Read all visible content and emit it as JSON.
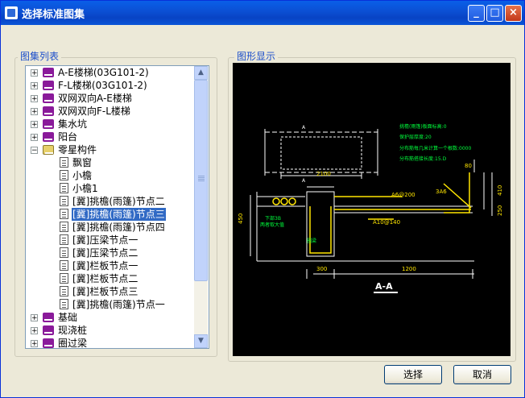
{
  "window": {
    "title": "选择标准图集"
  },
  "titlebar": {
    "min_glyph": "_",
    "max_glyph": "□",
    "close_glyph": "×"
  },
  "left_group": {
    "label": "图集列表"
  },
  "right_group": {
    "label": "图形显示"
  },
  "tree": {
    "nodes": [
      {
        "label": "A-E楼梯(03G101-2)"
      },
      {
        "label": "F-L楼梯(03G101-2)"
      },
      {
        "label": "双网双向A-E楼梯"
      },
      {
        "label": "双网双向F-L楼梯"
      },
      {
        "label": "集水坑"
      },
      {
        "label": "阳台"
      },
      {
        "label": "零星构件"
      },
      {
        "label": "飘窗"
      },
      {
        "label": "小檐"
      },
      {
        "label": "小檐1"
      },
      {
        "label": "[冀]挑檐(雨篷)节点二"
      },
      {
        "label": "[冀]挑檐(雨篷)节点三"
      },
      {
        "label": "[冀]挑檐(雨篷)节点四"
      },
      {
        "label": "[冀]压梁节点一"
      },
      {
        "label": "[冀]压梁节点二"
      },
      {
        "label": "[冀]栏板节点一"
      },
      {
        "label": "[冀]栏板节点二"
      },
      {
        "label": "[冀]栏板节点三"
      },
      {
        "label": "[冀]挑檐(雨篷)节点一"
      },
      {
        "label": "基础"
      },
      {
        "label": "现浇桩"
      },
      {
        "label": "圈过梁"
      }
    ],
    "plus": "+",
    "minus": "−"
  },
  "scrollbar": {
    "up": "▲",
    "down": "▼"
  },
  "drawing": {
    "section_mark": "A",
    "dim_top": "2100",
    "dim_bottom_left": "300",
    "dim_bottom_right": "1200",
    "dim_height_left": "450",
    "dim_right_1": "410",
    "dim_right_2": "250",
    "dim_right_top": "80",
    "rebar_1": "A6@200",
    "rebar_2": "3A6",
    "rebar_3": "A10@140",
    "beam_label": "圈梁",
    "left_note_1": "下部3B",
    "left_note_2": "两者取大值",
    "note_1": "挑檐(雨篷)板面标高:0",
    "note_2": "保护层厚度:20",
    "note_3": "分布筋每几米计算一个根数:0000",
    "note_4": "分布筋搭接长度:15.D",
    "section_title": "A-A"
  },
  "buttons": {
    "select": "选择",
    "cancel": "取消"
  }
}
